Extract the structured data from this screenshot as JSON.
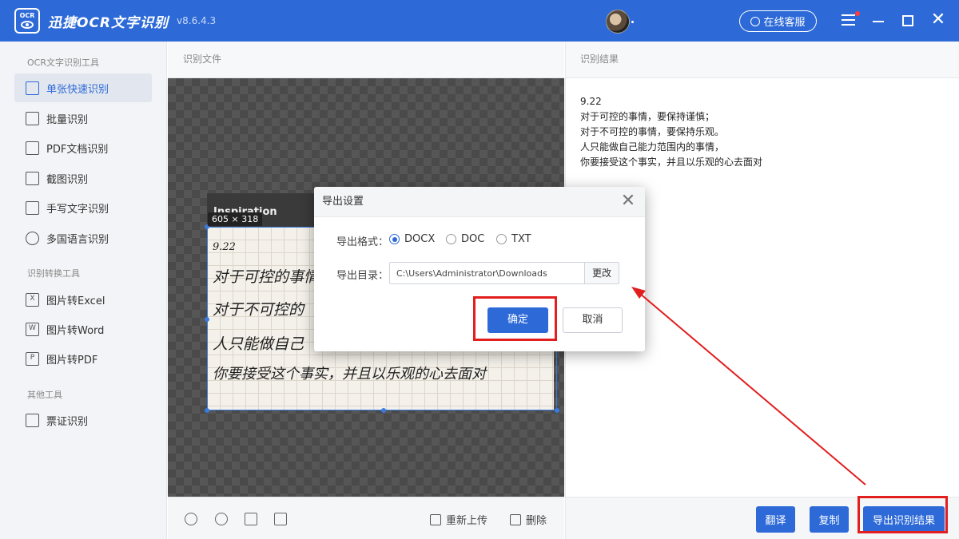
{
  "app": {
    "logo_text": "OCR",
    "title": "迅捷OCR文字识别",
    "version": "v8.6.4.3",
    "service_label": "在线客服"
  },
  "sidebar": {
    "sections": [
      {
        "label": "OCR文字识别工具"
      },
      {
        "label": "识别转换工具"
      },
      {
        "label": "其他工具"
      }
    ],
    "items": [
      {
        "label": "单张快速识别",
        "icon": "scan-icon",
        "active": true
      },
      {
        "label": "批量识别",
        "icon": "batch-icon"
      },
      {
        "label": "PDF文档识别",
        "icon": "pdf-icon"
      },
      {
        "label": "截图识别",
        "icon": "crop-icon"
      },
      {
        "label": "手写文字识别",
        "icon": "pen-icon"
      },
      {
        "label": "多国语言识别",
        "icon": "globe-icon"
      },
      {
        "label": "图片转Excel",
        "icon": "excel-icon",
        "glyph": "X"
      },
      {
        "label": "图片转Word",
        "icon": "word-icon",
        "glyph": "W"
      },
      {
        "label": "图片转PDF",
        "icon": "pdf-convert-icon",
        "glyph": "P"
      },
      {
        "label": "票证识别",
        "icon": "card-icon"
      }
    ]
  },
  "middle": {
    "header": "识别文件",
    "dimension_badge": "605 × 318",
    "paper_brand": "Inspiration",
    "handwriting": [
      "9.22",
      "对于可控的事情，",
      "对于不可控的",
      "人只能做自己",
      "你要接受这个事实，并且以乐观的心去面对"
    ],
    "reupload_label": "重新上传",
    "delete_label": "删除"
  },
  "right": {
    "header": "识别结果",
    "result_lines": [
      "9.22",
      "对于可控的事情，要保持谨慎；",
      "对于不可控的事情，要保持乐观。",
      "人只能做自己能力范围内的事情，",
      "你要接受这个事实，并且以乐观的心去面对"
    ],
    "translate_label": "翻译",
    "copy_label": "复制",
    "export_label": "导出识别结果"
  },
  "dialog": {
    "title": "导出设置",
    "format_label": "导出格式：",
    "formats": [
      {
        "label": "DOCX",
        "checked": true
      },
      {
        "label": "DOC",
        "checked": false
      },
      {
        "label": "TXT",
        "checked": false
      }
    ],
    "dir_label": "导出目录：",
    "dir_value": "C:\\Users\\Administrator\\Downloads",
    "change_label": "更改",
    "ok_label": "确定",
    "cancel_label": "取消"
  },
  "colors": {
    "brand": "#2d6ad8",
    "annotation": "#e21e1e"
  }
}
